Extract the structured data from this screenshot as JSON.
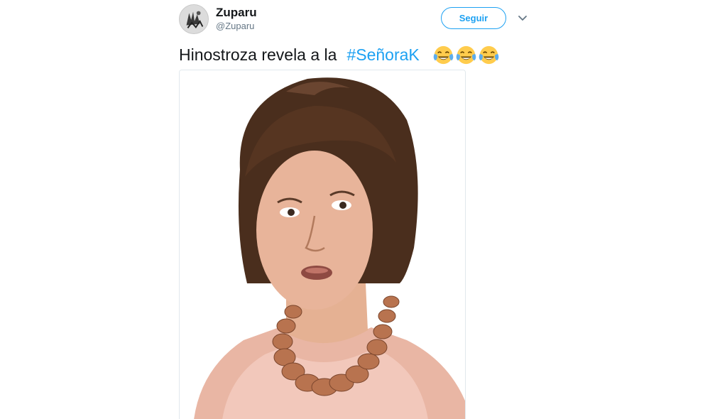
{
  "tweet": {
    "author": {
      "display_name": "Zuparu",
      "screen_name": "@Zuparu"
    },
    "follow_label": "Seguir",
    "text": {
      "plain": "Hinostroza revela a la",
      "hashtag": "#SeñoraK",
      "emojis": [
        "face-with-tears-of-joy",
        "face-with-tears-of-joy",
        "face-with-tears-of-joy"
      ]
    },
    "icons": {
      "more_options": "chevron-down-icon"
    }
  },
  "colors": {
    "link": "#1da1f2",
    "text": "#14171a",
    "secondary_text": "#657786",
    "border": "#e1e8ed"
  }
}
